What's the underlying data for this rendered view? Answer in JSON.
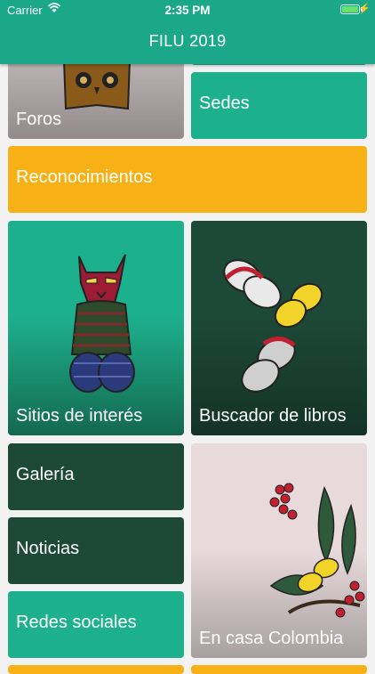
{
  "status_bar": {
    "carrier": "Carrier",
    "time": "2:35 PM"
  },
  "header": {
    "title": "FILU 2019"
  },
  "tiles": {
    "foros": "Foros",
    "sedes": "Sedes",
    "reconocimientos": "Reconocimientos",
    "sitios": "Sitios de interés",
    "buscador": "Buscador de libros",
    "galeria": "Galería",
    "noticias": "Noticias",
    "redes": "Redes sociales",
    "encasa": "En casa Colombia"
  },
  "colors": {
    "header": "#1aa888",
    "green_tile": "#1db08d",
    "dark_tile": "#1d4a38",
    "yellow_tile": "#f7b116",
    "pink_tile": "#e7d8da"
  },
  "icons": [
    "wifi-icon",
    "battery-icon",
    "charging-bolt-icon",
    "owl-book-illustration",
    "cat-illustration",
    "butterflies-illustration",
    "coffee-branch-illustration"
  ]
}
